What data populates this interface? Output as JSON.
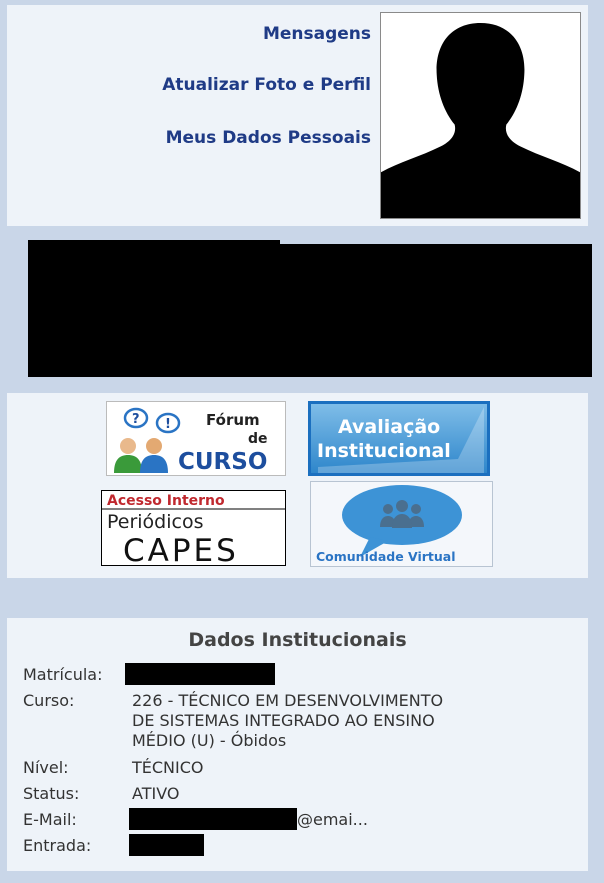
{
  "profile": {
    "links": {
      "mensagens": "Mensagens",
      "atualizar": "Atualizar Foto e Perfil",
      "dados": "Meus Dados Pessoais"
    },
    "photo_icon": "silhouette-avatar"
  },
  "quick_links": {
    "forum": {
      "word1": "Fórum",
      "word2": "de",
      "word3": "CURSO"
    },
    "avaliacao": {
      "line1": "Avaliação",
      "line2": "Institucional"
    },
    "capes": {
      "line1": "Acesso Interno",
      "line2": "Periódicos",
      "line3": "CAPES"
    },
    "comunidade": {
      "label": "Comunidade Virtual"
    }
  },
  "institutional": {
    "title": "Dados Institucionais",
    "fields": {
      "matricula_label": "Matrícula:",
      "curso_label": "Curso:",
      "curso_line1": "226 - TÉCNICO EM DESENVOLVIMENTO",
      "curso_line2": "DE SISTEMAS INTEGRADO AO ENSINO",
      "curso_line3": "MÉDIO (U) - Óbidos",
      "nivel_label": "Nível:",
      "nivel_value": "TÉCNICO",
      "status_label": "Status:",
      "status_value": "ATIVO",
      "email_label": "E-Mail:",
      "email_suffix": "@emai...",
      "entrada_label": "Entrada:"
    }
  },
  "colors": {
    "background": "#c9d6e8",
    "panel": "#eef3f9",
    "link": "#1f3b86",
    "text": "#333333"
  }
}
